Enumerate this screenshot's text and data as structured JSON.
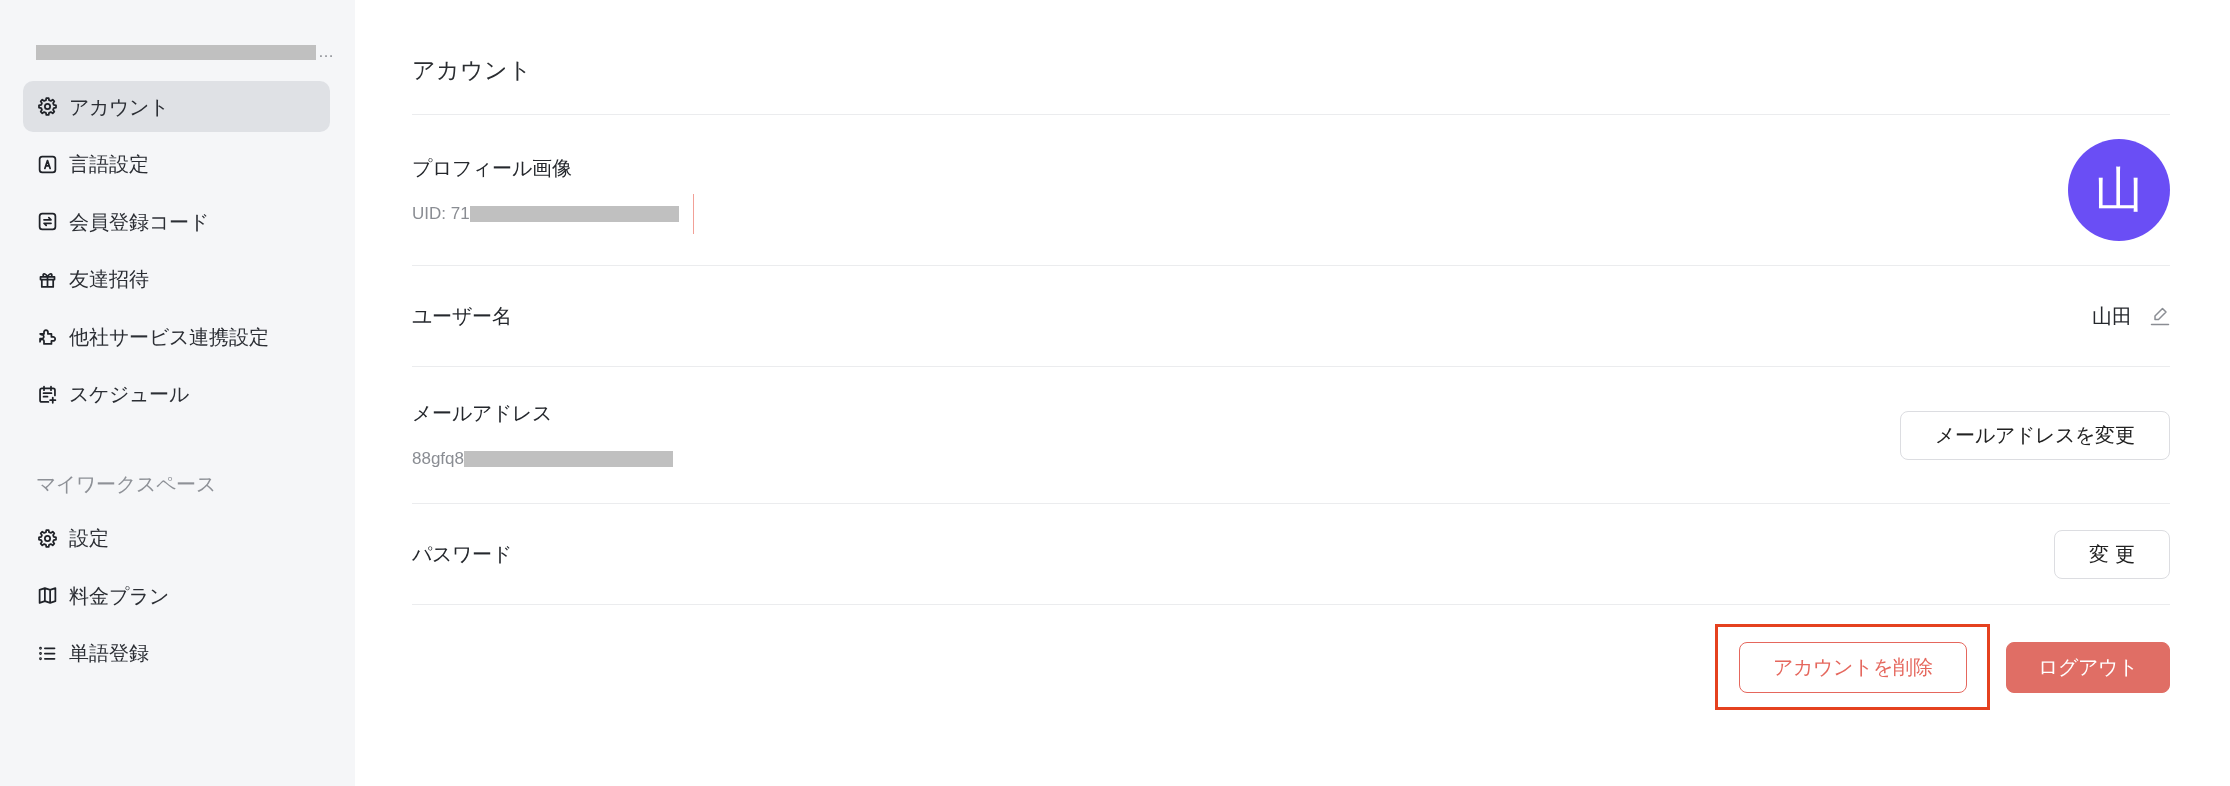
{
  "sidebar": {
    "account": {
      "redacted": true,
      "suffix": "…"
    },
    "items": [
      {
        "label": "アカウント",
        "selected": true
      },
      {
        "label": "言語設定",
        "selected": false
      },
      {
        "label": "会員登録コード",
        "selected": false
      },
      {
        "label": "友達招待",
        "selected": false
      },
      {
        "label": "他社サービス連携設定",
        "selected": false
      },
      {
        "label": "スケジュール",
        "selected": false
      }
    ],
    "sections": [
      {
        "title": "マイワークスペース",
        "items": [
          {
            "label": "設定",
            "selected": false
          },
          {
            "label": "料金プラン",
            "selected": false
          },
          {
            "label": "単語登録",
            "selected": false
          }
        ]
      }
    ]
  },
  "main": {
    "title": "アカウント",
    "rows": [
      {
        "kind": "avatar",
        "label": "プロフィール画像",
        "detail": {
          "text": "UID: 71",
          "redacted": true,
          "caret": true
        },
        "avatar": "山"
      },
      {
        "kind": "value",
        "label": "ユーザー名",
        "value": "山田"
      },
      {
        "kind": "button",
        "label": "メールアドレス",
        "detail": {
          "text": "88gfq8",
          "redacted": true
        },
        "button": "メールアドレスを変更"
      },
      {
        "kind": "button",
        "label": "パスワード",
        "button": "変 更"
      }
    ],
    "actions": [
      {
        "kind": "outline",
        "label": "アカウントを削除",
        "highlighted": true
      },
      {
        "kind": "solid",
        "label": "ログアウト",
        "highlighted": false
      }
    ]
  }
}
